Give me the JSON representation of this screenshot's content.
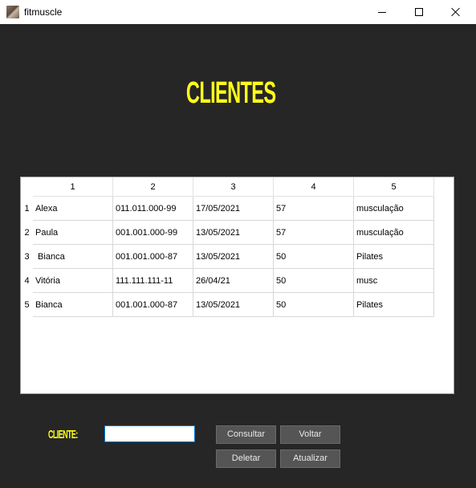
{
  "window": {
    "title": "fitmuscle"
  },
  "page": {
    "heading": "CLIENTES",
    "heading_color": "#ffff1a",
    "background_color": "#262626"
  },
  "table": {
    "columns": [
      "1",
      "2",
      "3",
      "4",
      "5"
    ],
    "row_numbers": [
      "1",
      "2",
      "3",
      "4",
      "5"
    ],
    "rows": [
      [
        "Alexa",
        "011.011.000-99",
        "17/05/2021",
        "57",
        "musculação"
      ],
      [
        "Paula",
        "001.001.000-99",
        "13/05/2021",
        "57",
        "musculação"
      ],
      [
        " Bianca",
        "001.001.000-87",
        "13/05/2021",
        "50",
        "Pilates"
      ],
      [
        "Vitória",
        "111.111.111-11",
        "26/04/21",
        "50",
        "musc"
      ],
      [
        "Bianca",
        "001.001.000-87",
        "13/05/2021",
        "50",
        "Pilates"
      ]
    ]
  },
  "form": {
    "cliente_label": "CLIENTE:",
    "cliente_value": ""
  },
  "buttons": {
    "consultar": "Consultar",
    "voltar": "Voltar",
    "deletar": "Deletar",
    "atualizar": "Atualizar"
  }
}
